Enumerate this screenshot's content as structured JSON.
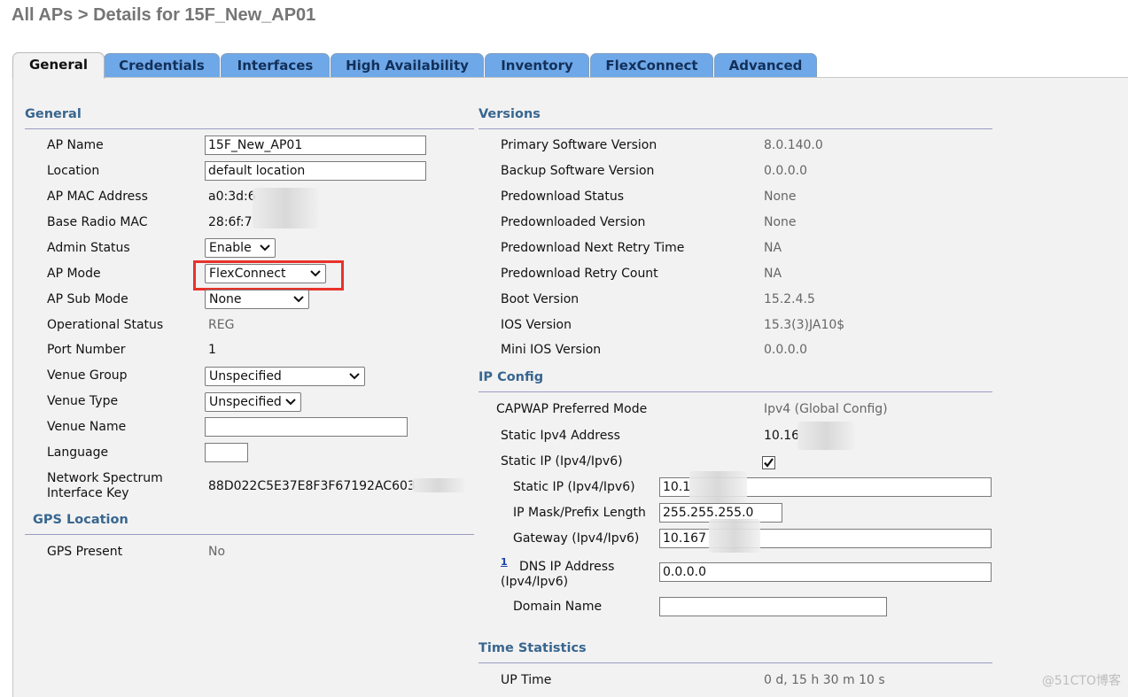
{
  "page": {
    "title": "All APs > Details for 15F_New_AP01"
  },
  "tabs": [
    "General",
    "Credentials",
    "Interfaces",
    "High Availability",
    "Inventory",
    "FlexConnect",
    "Advanced"
  ],
  "general": {
    "heading": "General",
    "ap_name_label": "AP Name",
    "ap_name_value": "15F_New_AP01",
    "location_label": "Location",
    "location_value": "default location",
    "ap_mac_label": "AP MAC Address",
    "ap_mac_value": "a0:3d:6",
    "base_radio_mac_label": "Base Radio MAC",
    "base_radio_mac_value": "28:6f:7",
    "admin_status_label": "Admin Status",
    "admin_status_value": "Enable",
    "ap_mode_label": "AP Mode",
    "ap_mode_value": "FlexConnect",
    "ap_sub_mode_label": "AP Sub Mode",
    "ap_sub_mode_value": "None",
    "operational_status_label": "Operational Status",
    "operational_status_value": "REG",
    "port_number_label": "Port Number",
    "port_number_value": "1",
    "venue_group_label": "Venue Group",
    "venue_group_value": "Unspecified",
    "venue_type_label": "Venue Type",
    "venue_type_value": "Unspecified",
    "venue_name_label": "Venue Name",
    "venue_name_value": "",
    "language_label": "Language",
    "language_value": "",
    "nsi_key_label_1": "Network Spectrum",
    "nsi_key_label_2": "Interface Key",
    "nsi_key_value": "88D022C5E37E8F3F67192AC603"
  },
  "gps": {
    "heading": "GPS Location",
    "present_label": "GPS Present",
    "present_value": "No"
  },
  "versions": {
    "heading": "Versions",
    "rows": [
      {
        "label": "Primary Software Version",
        "value": "8.0.140.0"
      },
      {
        "label": "Backup Software Version",
        "value": "0.0.0.0"
      },
      {
        "label": "Predownload Status",
        "value": "None"
      },
      {
        "label": "Predownloaded Version",
        "value": "None"
      },
      {
        "label": "Predownload Next Retry Time",
        "value": "NA"
      },
      {
        "label": "Predownload Retry Count",
        "value": "NA"
      },
      {
        "label": "Boot Version",
        "value": "15.2.4.5"
      },
      {
        "label": "IOS Version",
        "value": "15.3(3)JA10$"
      },
      {
        "label": "Mini IOS Version",
        "value": "0.0.0.0"
      }
    ]
  },
  "ip_config": {
    "heading": "IP Config",
    "capwap_label": "CAPWAP Preferred Mode",
    "capwap_value": "Ipv4 (Global Config)",
    "static_ipv4_label": "Static Ipv4 Address",
    "static_ipv4_value": "10.16",
    "static_ip_label": "Static IP (Ipv4/Ipv6)",
    "static_ip_checked": true,
    "static_ip_field_label": "Static IP (Ipv4/Ipv6)",
    "static_ip_field_value": "10.1",
    "mask_label": "IP Mask/Prefix Length",
    "mask_value": "255.255.255.0",
    "gateway_label": "Gateway (Ipv4/Ipv6)",
    "gateway_value": "10.167",
    "dns_footnote": "1",
    "dns_label_1": "DNS IP Address",
    "dns_label_2": "(Ipv4/Ipv6)",
    "dns_value": "0.0.0.0",
    "domain_label": "Domain Name",
    "domain_value": ""
  },
  "time_stats": {
    "heading": "Time Statistics",
    "uptime_label": "UP Time",
    "uptime_value": "0 d, 15 h 30 m 10 s"
  },
  "watermark": "@51CTO博客",
  "colors": {
    "tab_blue": "#6fa8e8",
    "section_heading": "#38668f",
    "highlight": "#e8332a"
  },
  "icons": {
    "dropdown": "chevron-down-icon",
    "check": "check-icon"
  }
}
